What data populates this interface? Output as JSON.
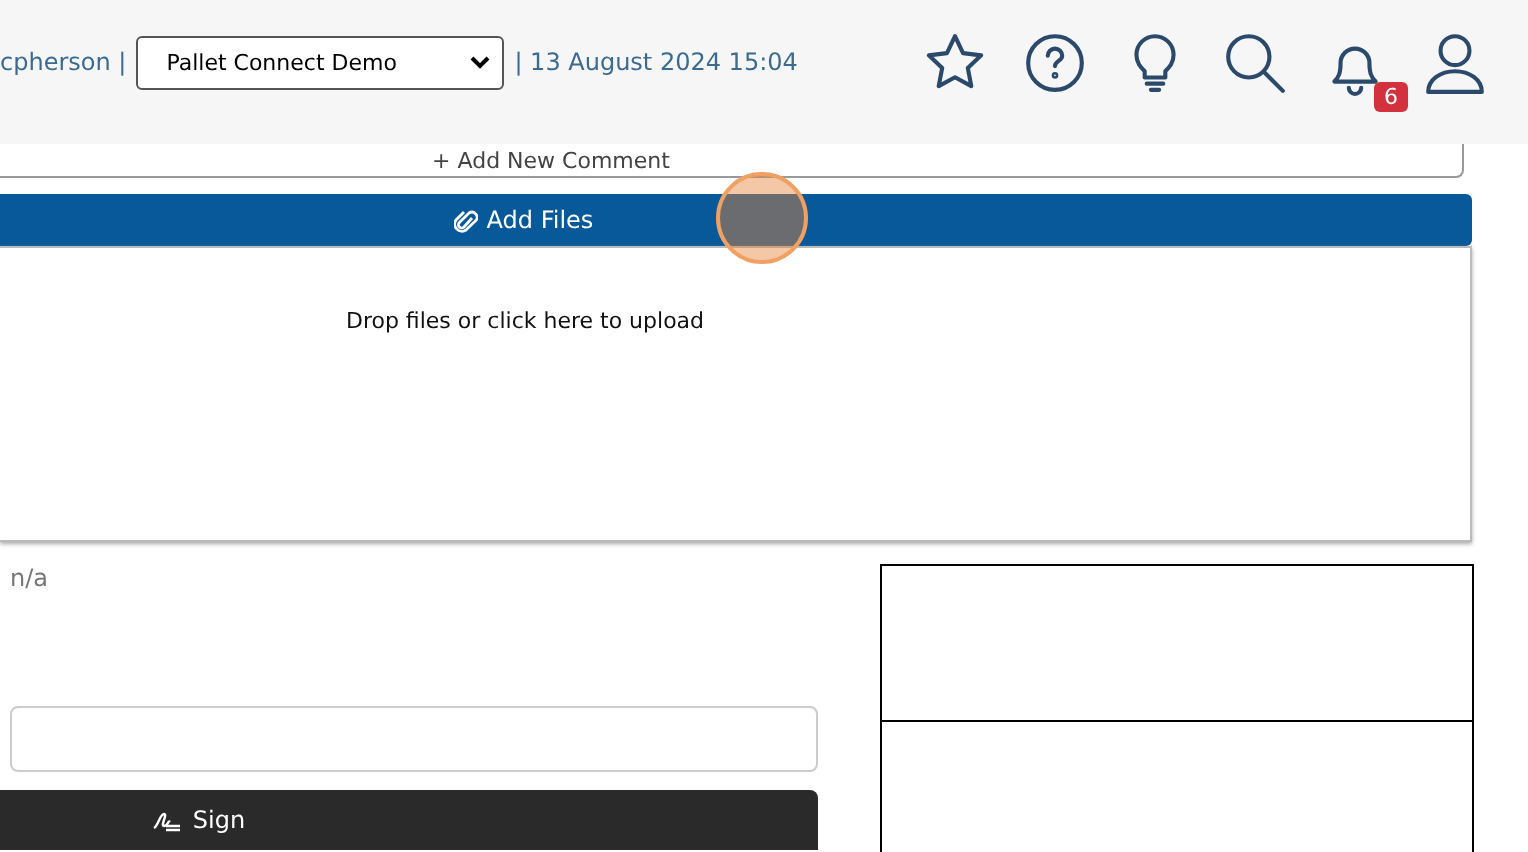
{
  "header": {
    "user": "cpherson |",
    "company_select": {
      "value": "Pallet Connect Demo"
    },
    "datetime": "| 13 August 2024 15:04",
    "notifications_badge": "6"
  },
  "comment_button": "+ Add New Comment",
  "add_files_button": "Add Files",
  "dropzone": "Drop files or click here to upload",
  "value_text": "n/a",
  "sign_button": "Sign"
}
